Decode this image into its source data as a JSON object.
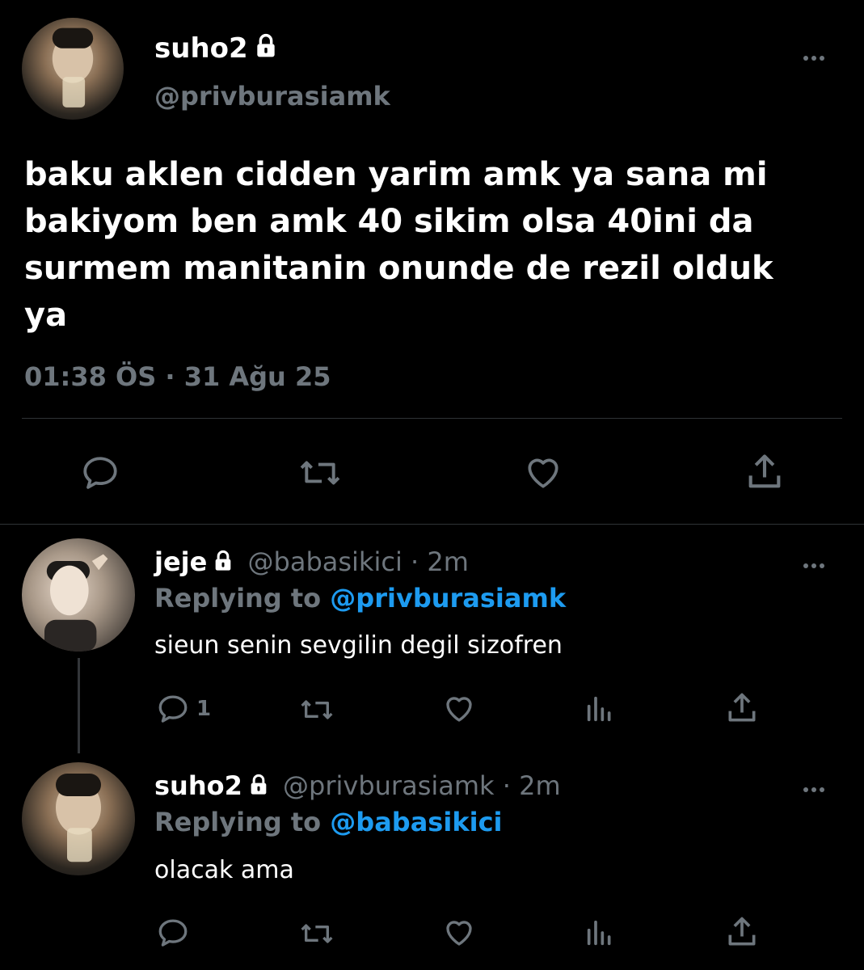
{
  "main_tweet": {
    "display_name": "suho2",
    "handle": "@privburasiamk",
    "text_lines": [
      "baku aklen cidden yarim amk ya sana mi",
      "bakiyom ben amk 40 sikim olsa 40ini da",
      "surmem manitanin onunde de rezil olduk",
      "ya"
    ],
    "time": "01:38 ÖS",
    "separator": "·",
    "date": "31 Ağu 25"
  },
  "reply1": {
    "display_name": "jeje",
    "handle": "@babasikici",
    "time_sep": "·",
    "time": "2m",
    "replying_label": "Replying to",
    "replying_to": "@privburasiamk",
    "text": "sieun senin sevgilin degil sizofren",
    "reply_count": "1"
  },
  "reply2": {
    "display_name": "suho2",
    "handle": "@privburasiamk",
    "time_sep": "·",
    "time": "2m",
    "replying_label": "Replying to",
    "replying_to": "@babasikici",
    "text": "olacak ama"
  },
  "colors": {
    "background": "#000000",
    "muted": "#6e767d",
    "link": "#1d9bf0",
    "divider": "#2f3336"
  }
}
